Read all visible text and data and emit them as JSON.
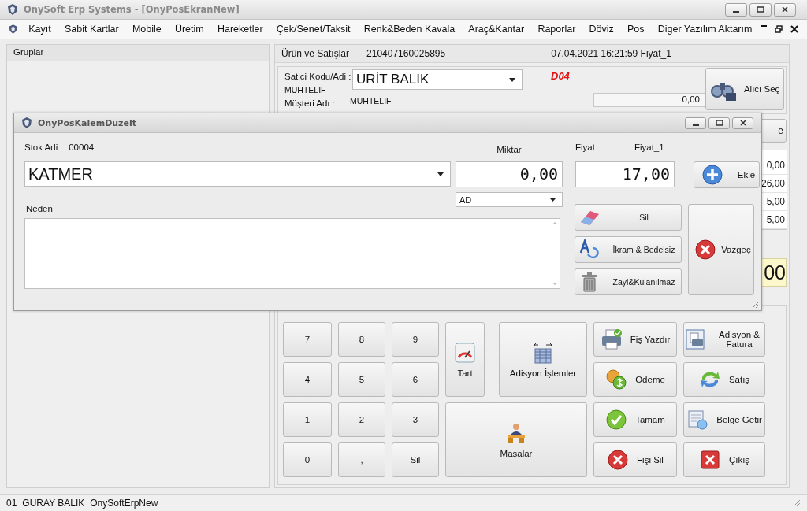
{
  "window": {
    "title": "OnySoft Erp Systems - [OnyPosEkranNew]"
  },
  "menu": [
    "Kayıt",
    "Sabit Kartlar",
    "Mobile",
    "Üretim",
    "Hareketler",
    "Çek/Senet/Taksit",
    "Renk&Beden Kavala",
    "Araç&Kantar",
    "Raporlar",
    "Döviz",
    "Pos",
    "Diger Yazılım Aktarım"
  ],
  "groups_panel": {
    "title": "Gruplar"
  },
  "sales_header": {
    "title": "Ürün ve Satışlar",
    "receipt_no": "210407160025895",
    "datetime": "07.04.2021 16:21:59 Fiyat_1"
  },
  "customer": {
    "seller_label": "Satici Kodu/Adi :",
    "seller": "URİT BALIK",
    "seller_sub": "MUHTELIF",
    "code": "D04",
    "customer_label": "Müşteri Adı :",
    "customer_name": "MUHTELIF",
    "balance": "0,00",
    "select_button": "Alıcı Seç"
  },
  "partial": {
    "button_text": "e",
    "amounts": [
      "0,00",
      "26,00",
      "5,00",
      "5,00"
    ],
    "total": "00"
  },
  "keypad": [
    {
      "label": "7",
      "kind": "key"
    },
    {
      "label": "8",
      "kind": "key"
    },
    {
      "label": "9",
      "kind": "key"
    },
    {
      "label": "Tart",
      "kind": "gauge"
    },
    {
      "label": "Adisyon İşlemler",
      "kind": "grid"
    },
    {
      "label": "Fiş Yazdır",
      "kind": "printer"
    },
    {
      "label": "Adisyon & Fatura",
      "kind": "invoice"
    },
    {
      "label": "4",
      "kind": "key"
    },
    {
      "label": "5",
      "kind": "key"
    },
    {
      "label": "6",
      "kind": "key"
    },
    {
      "label": "Ödeme",
      "kind": "coins"
    },
    {
      "label": "Satış",
      "kind": "cycle"
    },
    {
      "label": "1",
      "kind": "key"
    },
    {
      "label": "2",
      "kind": "key"
    },
    {
      "label": "3",
      "kind": "key"
    },
    {
      "label": "Masalar",
      "kind": "desk"
    },
    {
      "label": "Tamam",
      "kind": "check"
    },
    {
      "label": "Belge Getir",
      "kind": "fetch"
    },
    {
      "label": "0",
      "kind": "key"
    },
    {
      "label": ",",
      "kind": "key"
    },
    {
      "label": "Sil",
      "kind": "key"
    },
    {
      "label": "Fişi Sil",
      "kind": "cross"
    },
    {
      "label": "Çıkış",
      "kind": "exit"
    }
  ],
  "dialog": {
    "title": "OnyPosKalemDuzelt",
    "stock_label": "Stok Adi",
    "stock_code": "00004",
    "stock_name": "KATMER",
    "qty_label": "Miktar",
    "qty": "0,00",
    "unit": "AD",
    "price_label": "Fiyat",
    "price_list": "Fiyat_1",
    "price": "17,00",
    "reason_label": "Neden",
    "buttons": [
      {
        "label": "Ekle",
        "kind": "add"
      },
      {
        "label": "Sil",
        "kind": "erase"
      },
      {
        "label": "İkram & Bedelsiz",
        "kind": "treat"
      },
      {
        "label": "Zayi&Kulanılmaz",
        "kind": "trash"
      },
      {
        "label": "Vazgeç",
        "kind": "cancel"
      }
    ]
  },
  "status_bar": [
    "01",
    "GURAY BALIK",
    "OnySoftErpNew"
  ]
}
